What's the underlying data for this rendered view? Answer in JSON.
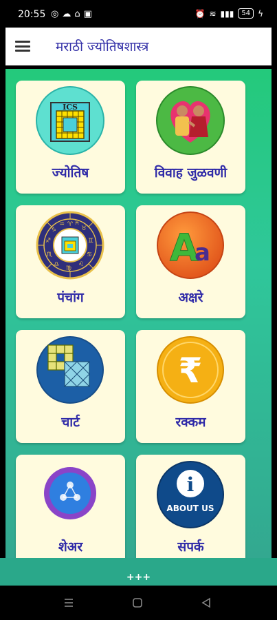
{
  "status_bar": {
    "time": "20:55",
    "battery": "54"
  },
  "app_bar": {
    "title": "मराठी ज्योतिषशास्त्र"
  },
  "cards": [
    {
      "label": "ज्योतिष",
      "icon": "ics-grid-icon",
      "icon_text": "ICS"
    },
    {
      "label": "विवाह जुळवणी",
      "icon": "marriage-couple-icon"
    },
    {
      "label": "पंचांग",
      "icon": "zodiac-wheel-icon"
    },
    {
      "label": "अक्षरे",
      "icon": "letters-aa-icon",
      "icon_text_big": "A",
      "icon_text_small": "a"
    },
    {
      "label": "चार्ट",
      "icon": "chart-grid-icon"
    },
    {
      "label": "रक्कम",
      "icon": "rupee-icon",
      "icon_text": "₹"
    },
    {
      "label": "शेअर",
      "icon": "share-icon"
    },
    {
      "label": "संपर्क",
      "icon": "about-us-icon",
      "icon_text": "ABOUT US",
      "icon_glyph": "i"
    }
  ],
  "bottom": {
    "more_text": "+++"
  },
  "colors": {
    "accent": "#2f2aa8",
    "card_bg": "#fffbde",
    "gradient_top": "#24c97b",
    "gradient_bottom": "#33a890"
  }
}
